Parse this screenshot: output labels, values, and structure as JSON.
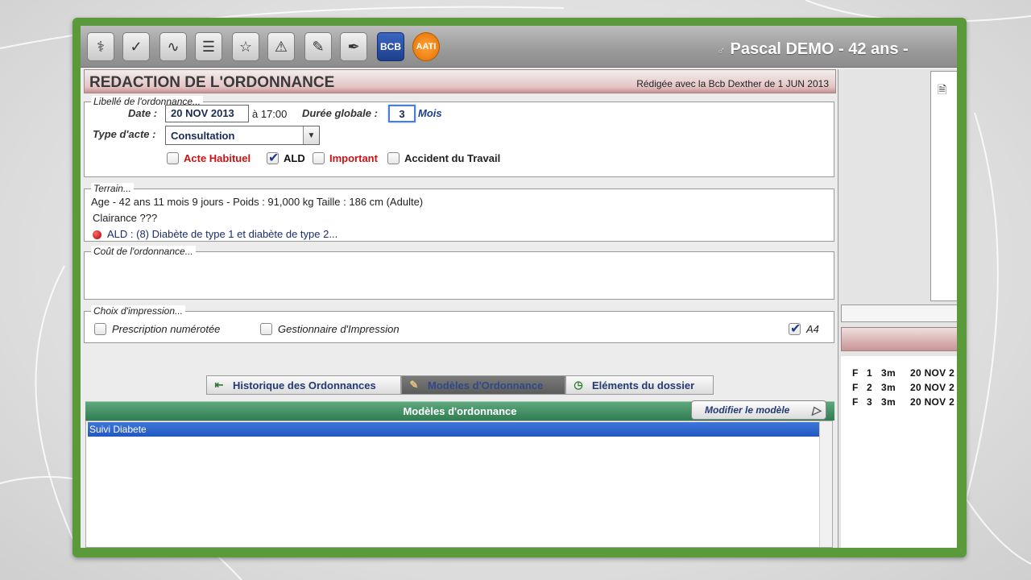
{
  "toolbar": {
    "icons": [
      {
        "name": "stethoscope-icon",
        "glyph": "⚕"
      },
      {
        "name": "prescription-check-icon",
        "glyph": "✓"
      },
      {
        "name": "chart-icon",
        "glyph": "∿"
      },
      {
        "name": "lab-results-icon",
        "glyph": "☰"
      },
      {
        "name": "imaging-icon",
        "glyph": "☆"
      },
      {
        "name": "atcd-warning-icon",
        "glyph": "⚠"
      },
      {
        "name": "document-edit-icon",
        "glyph": "✎"
      },
      {
        "name": "pen-sign-icon",
        "glyph": "✒"
      },
      {
        "name": "bcb-icon",
        "glyph": "BCB"
      },
      {
        "name": "aati-icon",
        "glyph": "AATI"
      }
    ],
    "patient_sex_symbol": "♂",
    "patient": "Pascal DEMO - 42 ans -"
  },
  "header": {
    "title": "REDACTION DE L'ORDONNANCE",
    "source": "Rédigée avec la Bcb Dexther de 1 JUN 2013"
  },
  "libelle": {
    "legend": "Libellé de l'ordonnance...",
    "date_label": "Date :",
    "date_value": "20 NOV 2013",
    "time_text": "à 17:00",
    "duree_label": "Durée globale :",
    "duree_value": "3",
    "duree_unit": "Mois",
    "type_label": "Type d'acte :",
    "type_value": "Consultation",
    "checkboxes": [
      {
        "label": "Acte Habituel",
        "checked": false,
        "color": "#d01010"
      },
      {
        "label": "ALD",
        "checked": true,
        "color": "#111111"
      },
      {
        "label": "Important",
        "checked": false,
        "color": "#d01010"
      },
      {
        "label": "Accident du Travail",
        "checked": false,
        "color": "#222222"
      }
    ]
  },
  "terrain": {
    "legend": "Terrain...",
    "line1": "Age - 42 ans 11 mois 9 jours  -  Poids : 91,000 kg Taille : 186 cm (Adulte)",
    "line2": "Clairance ???",
    "ald": "ALD :  (8) Diabète de type 1 et diabète de type 2..."
  },
  "cout": {
    "legend": "Coût de l'ordonnance..."
  },
  "impression": {
    "legend": "Choix d'impression...",
    "options": [
      {
        "label": "Prescription numérotée",
        "checked": false
      },
      {
        "label": "Gestionnaire d'Impression",
        "checked": false
      },
      {
        "label": "A4",
        "checked": true
      }
    ]
  },
  "tabs": [
    {
      "label": "Historique des Ordonnances",
      "active": false,
      "icon": "history-icon"
    },
    {
      "label": "Modèles d'Ordonnance",
      "active": true,
      "icon": "models-icon"
    },
    {
      "label": "Eléments du dossier",
      "active": false,
      "icon": "clock-icon"
    }
  ],
  "models": {
    "header": "Modèles d'ordonnance",
    "modify_button": "Modifier le modèle",
    "items": [
      "Suivi Diabete"
    ]
  },
  "right_panel": {
    "prescriptions": [
      {
        "code": "F",
        "num": "1",
        "dur": "3m",
        "date": "20 NOV 2"
      },
      {
        "code": "F",
        "num": "2",
        "dur": "3m",
        "date": "20 NOV 2"
      },
      {
        "code": "F",
        "num": "3",
        "dur": "3m",
        "date": "20 NOV 2"
      }
    ]
  },
  "colors": {
    "frame": "#5a9a3a",
    "accent_blue": "#2158c2",
    "header_red": "#c89090",
    "models_green": "#2f7d52"
  }
}
